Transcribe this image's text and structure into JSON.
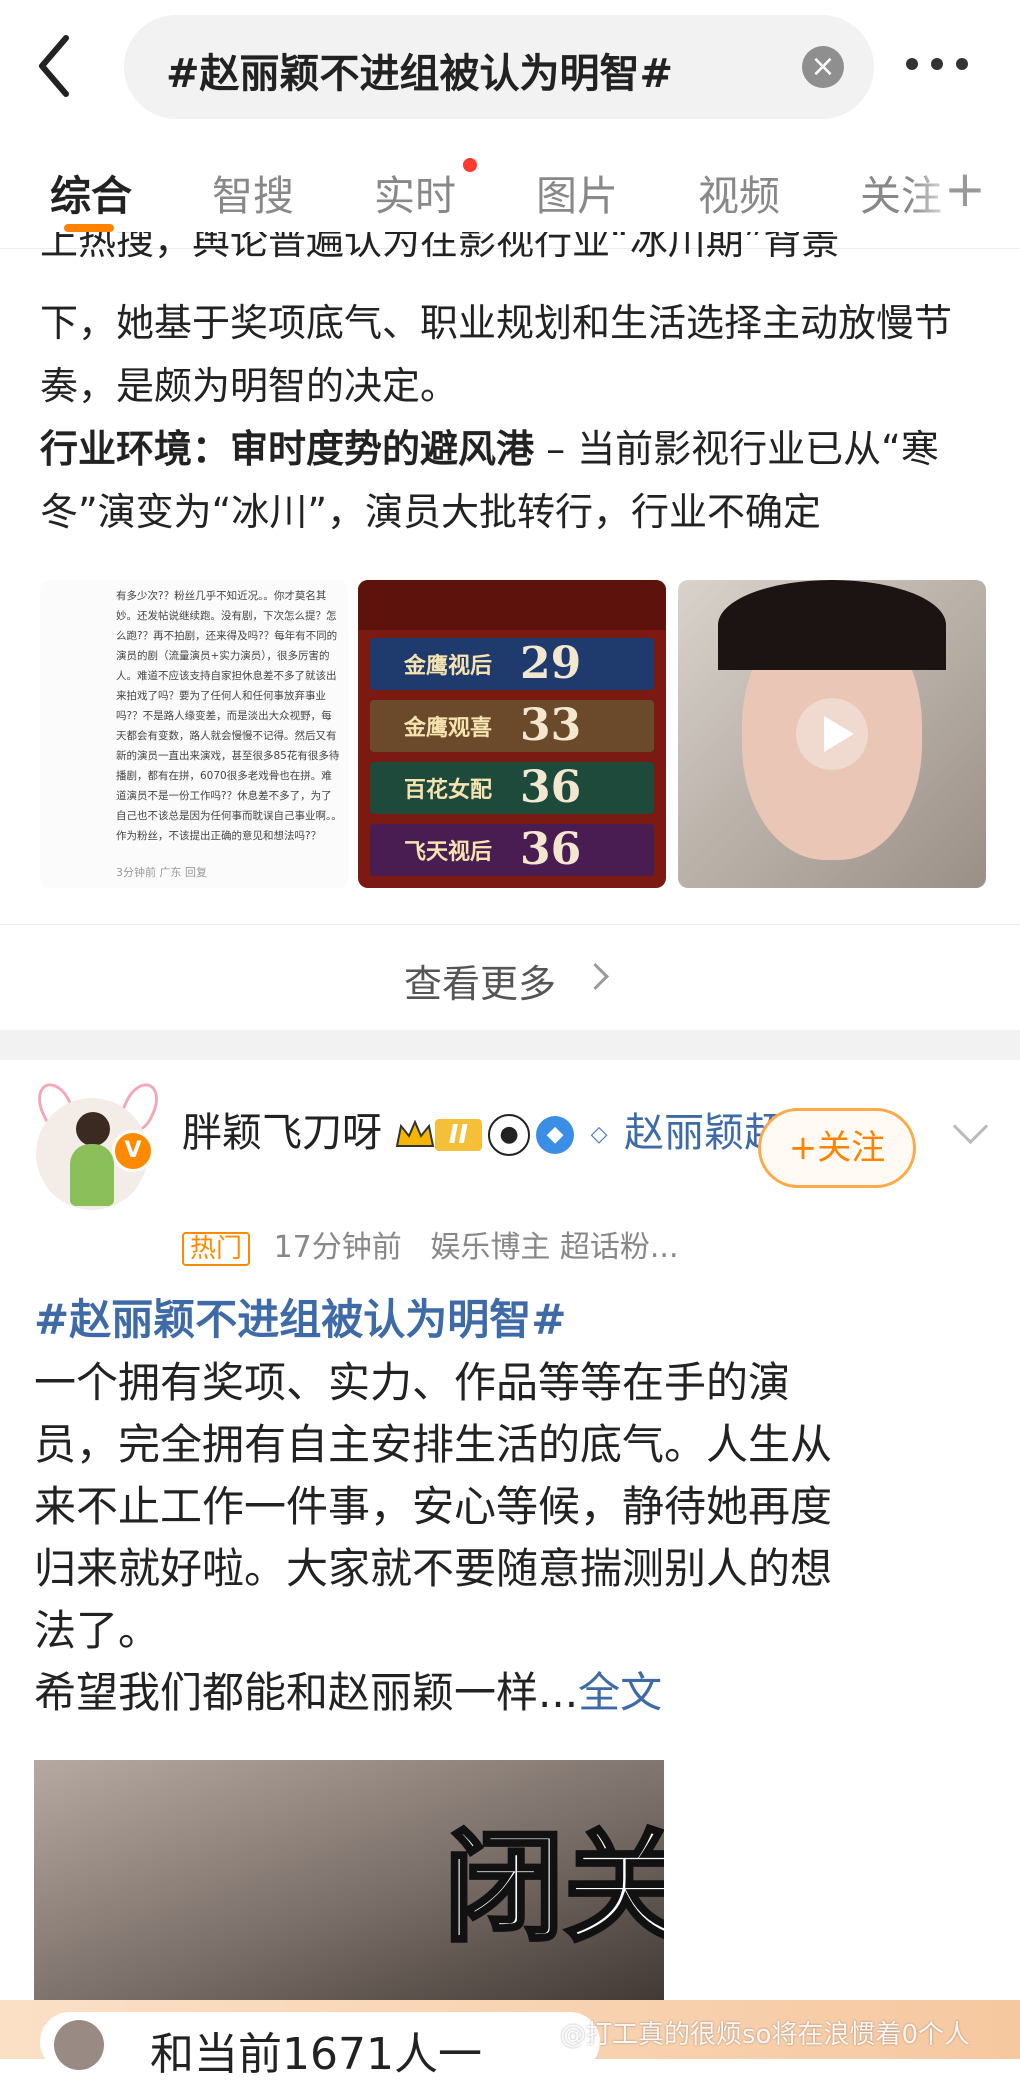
{
  "search": {
    "query": "#赵丽颖不进组被认为明智#",
    "clear_glyph": "×"
  },
  "tabs": [
    {
      "label": "综合",
      "active": true
    },
    {
      "label": "智搜"
    },
    {
      "label": "实时",
      "has_dot": true
    },
    {
      "label": "图片"
    },
    {
      "label": "视频"
    },
    {
      "label": "关注"
    }
  ],
  "card1": {
    "clipped_line": "上热搜，舆论普遍认为在影视行业“冰川期”背景",
    "paragraph1": "下，她基于奖项底气、职业规划和生活选择主动放慢节奏，是颇为明智的决定。",
    "heading": "行业环境：审时度势的避风港",
    "paragraph2": " – 当前影视行业已从“寒冬”演变为“冰川”，演员大批转行，行业不确定",
    "image1_text": "有多少次?？粉丝几乎不知近况。。你才莫名其妙。还发帖说继续跑。没有剧，下次怎么提？怎么跑?？再不拍剧，还来得及吗?？每年有不同的演员的剧（流量演员+实力演员），很多厉害的人。难道不应该支持自家担休息差不多了就该出来拍戏了吗？要为了任何人和任何事放弃事业吗?？不是路人缘变差，而是淡出大众视野，每天都会有变数，路人就会慢慢不记得。然后又有新的演员一直出来演戏，甚至很多85花有很多待播剧，都有在拼，6070很多老戏骨也在拼。难道演员不是一份工作吗?？休息差不多了，为了自己也不该总是因为任何事而耽误自己事业啊。。作为粉丝，不该提出正确的意见和想法吗?？",
    "image1_meta": "3分钟前 广东  回复",
    "poster_rows": [
      {
        "label": "金鹰视后",
        "num": "29"
      },
      {
        "label": "金鹰观喜",
        "num": "33"
      },
      {
        "label": "百花女配",
        "num": "36"
      },
      {
        "label": "飞天视后",
        "num": "36"
      }
    ],
    "view_more": "查看更多"
  },
  "post": {
    "username": "胖颖飞刀呀",
    "rank": "II",
    "supertopic": "赵丽颖超话",
    "follow": "+关注",
    "hot_tag": "热门",
    "time": "17分钟前",
    "meta": "娱乐博主 超话粉...",
    "hashtag": "#赵丽颖不进组被认为明智#",
    "body_lines": [
      "一个拥有奖项、实力、作品等等在手的演",
      "员，完全拥有自主安排生活的底气。人生从",
      "来不止工作一件事，安心等候，静待她再度",
      "归来就好啦。大家就不要随意揣测别人的想",
      "法了。"
    ],
    "last_line": "希望我们都能和赵丽颖一样...",
    "fulltext": "全文",
    "image_overlay": "闭关"
  },
  "live_bar": {
    "text": "和当前1671人一"
  },
  "watermark": "@打工真的很烦so将在浪惯着0个人",
  "colors": {
    "accent": "#ff8200",
    "link": "#3f6aa8",
    "dot": "#ff3b30"
  }
}
